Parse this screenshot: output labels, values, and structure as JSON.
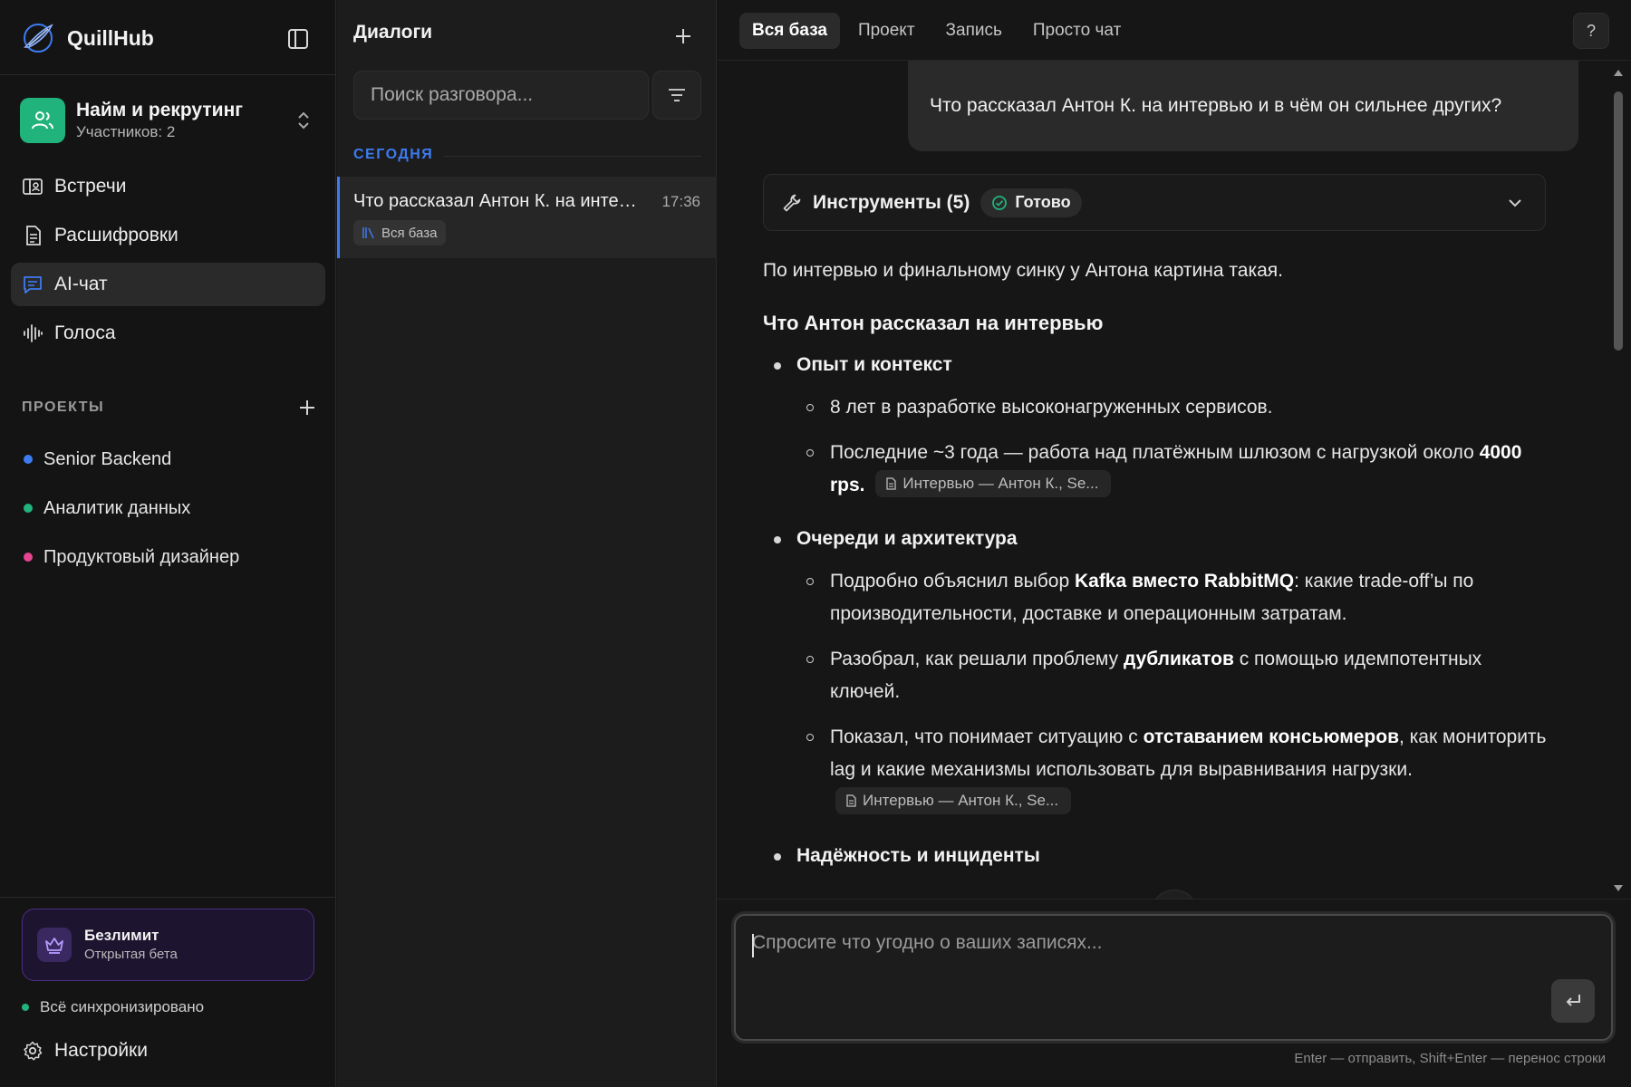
{
  "sidebar": {
    "brand": "QuillHub",
    "workspace": {
      "title": "Найм и рекрутинг",
      "members": "Участников: 2"
    },
    "nav": [
      {
        "label": "Встречи",
        "icon": "meetings-icon"
      },
      {
        "label": "Расшифровки",
        "icon": "transcript-icon"
      },
      {
        "label": "AI-чат",
        "icon": "chat-icon",
        "active": true
      },
      {
        "label": "Голоса",
        "icon": "waveform-icon"
      }
    ],
    "projects_title": "ПРОЕКТЫ",
    "projects": [
      {
        "label": "Senior Backend",
        "color": "#3d7bf0"
      },
      {
        "label": "Аналитик данных",
        "color": "#21b37c"
      },
      {
        "label": "Продуктовый дизайнер",
        "color": "#e6458f"
      }
    ],
    "plan": {
      "title": "Безлимит",
      "subtitle": "Открытая бета"
    },
    "sync_status": "Всё синхронизировано",
    "settings_label": "Настройки"
  },
  "dialogs": {
    "title": "Диалоги",
    "search_placeholder": "Поиск разговора...",
    "group_label": "СЕГОДНЯ",
    "items": [
      {
        "title": "Что рассказал Антон К. на интервью и в чём он сильнее других?",
        "time": "17:36",
        "tag": "Вся база"
      }
    ]
  },
  "main": {
    "tabs": [
      "Вся база",
      "Проект",
      "Запись",
      "Просто чат"
    ],
    "help": "?",
    "user_message": "Что рассказал Антон К. на интервью и в чём он сильнее других?",
    "tools": {
      "label": "Инструменты (5)",
      "status": "Готово"
    },
    "answer": {
      "intro": "По интервью и финальному синку у Антона картина такая.",
      "heading": "Что Антон рассказал на интервью",
      "s1_title": "Опыт и контекст",
      "s1_i1": "8 лет в разработке высоконагруженных сервисов.",
      "s1_i2_a": "Последние ~3 года — работа над платёжным шлюзом с нагрузкой около ",
      "s1_i2_b": "4000 rps.",
      "source": "Интервью — Антон К., Se...",
      "s2_title": "Очереди и архитектура",
      "s2_i1_a": "Подробно объяснил выбор ",
      "s2_i1_b": "Kafka вместо RabbitMQ",
      "s2_i1_c": ": какие trade-off’ы по производительности, доставке и операционным затратам.",
      "s2_i2_a": "Разобрал, как решали проблему ",
      "s2_i2_b": "дубликатов",
      "s2_i2_c": " с помощью идемпотентных ключей.",
      "s2_i3_a": "Показал, что понимает ситуацию с ",
      "s2_i3_b": "отставанием консьюмеров",
      "s2_i3_c": ", как мониторить lag и какие механизмы использовать для выравнивания нагрузки.",
      "s3_title": "Надёжность и инциденты"
    },
    "composer_placeholder": "Спросите что угодно о ваших записях...",
    "hint": "Enter — отправить, Shift+Enter — перенос строки"
  },
  "colors": {
    "accent": "#3d7bf0",
    "success": "#21b37c",
    "plan_border": "#4b2f84"
  }
}
